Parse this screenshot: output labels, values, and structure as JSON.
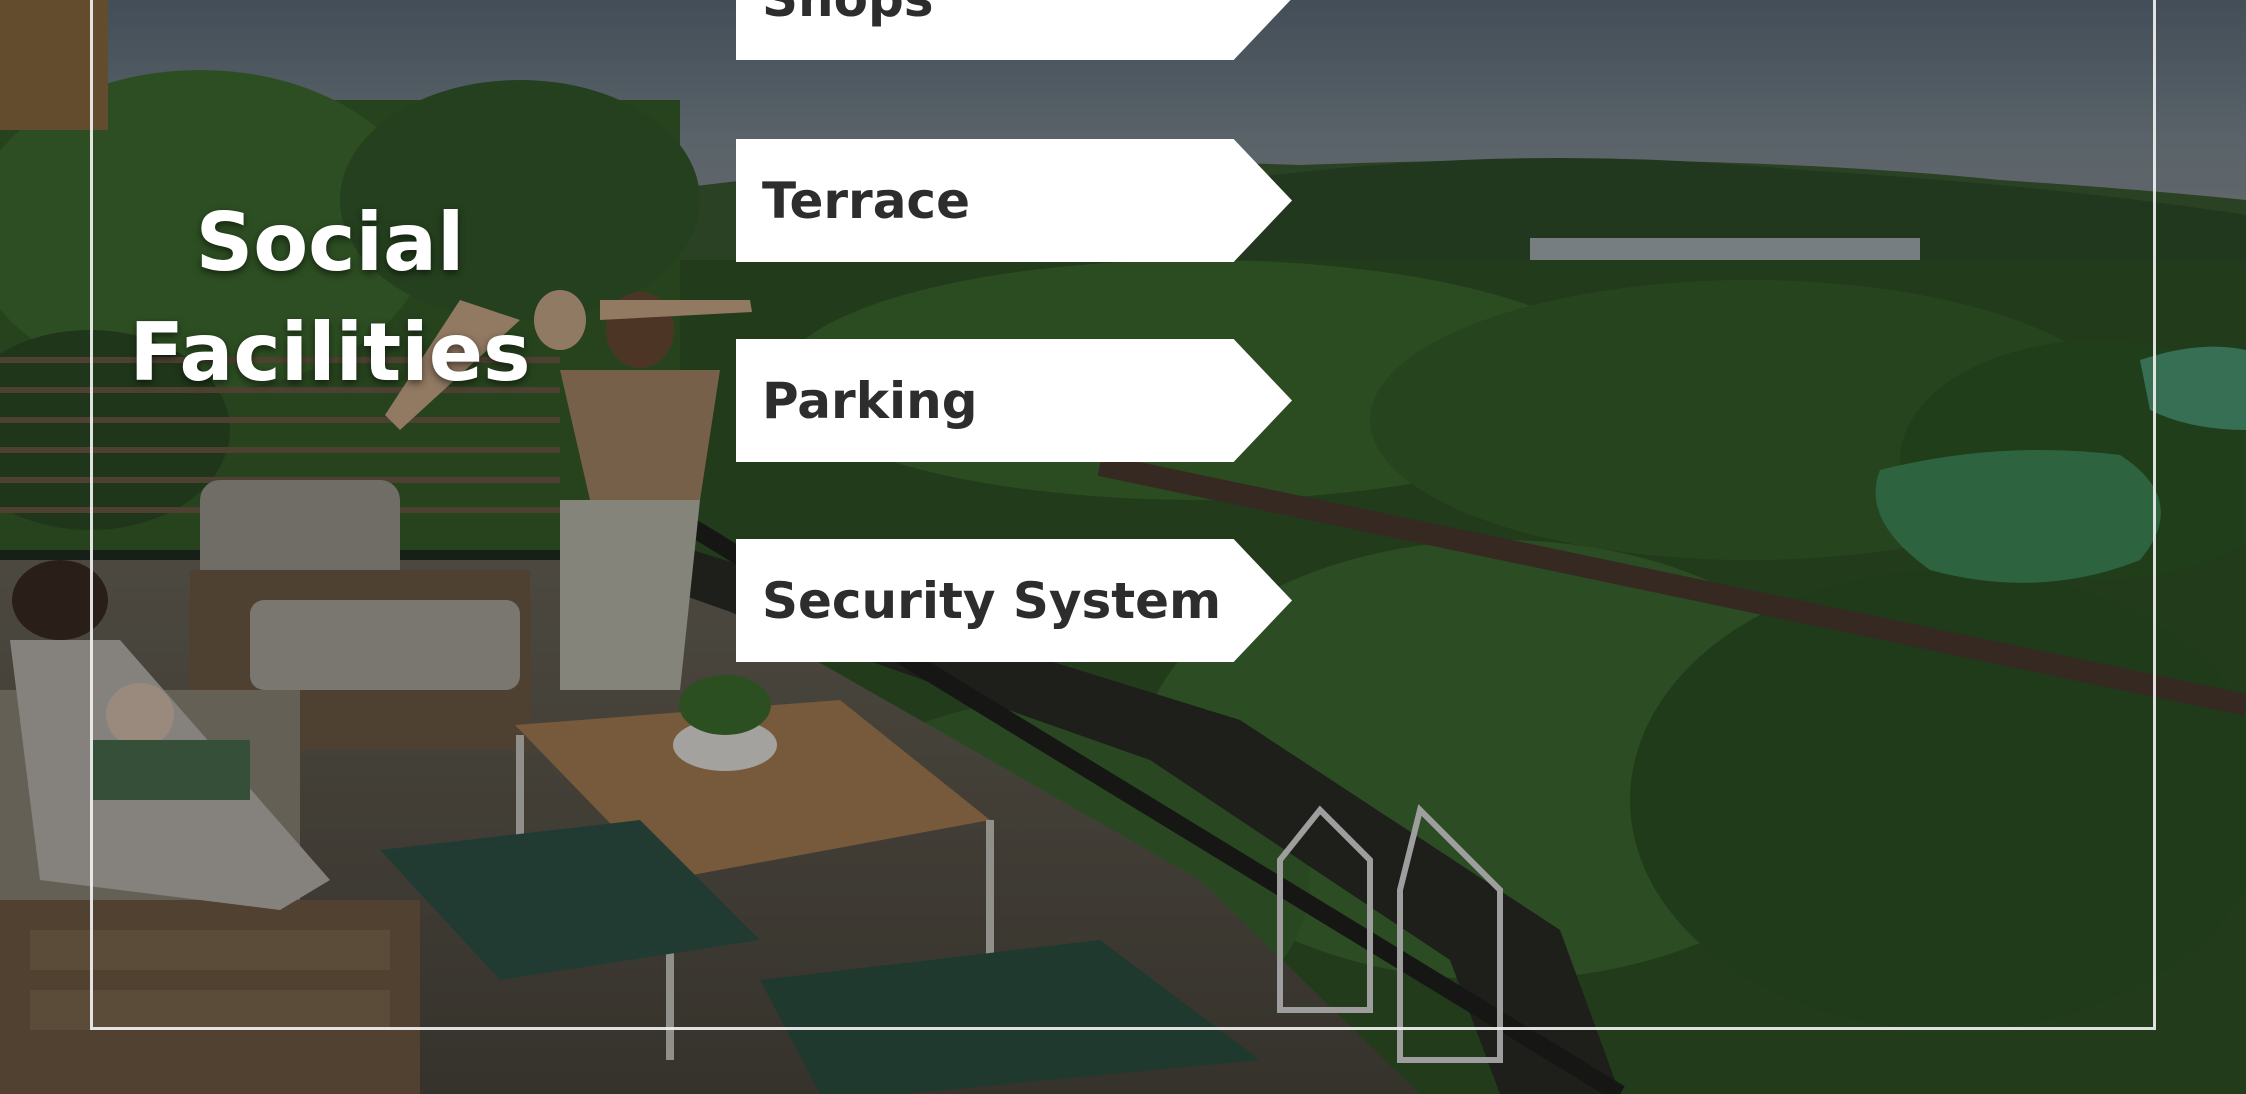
{
  "heading": {
    "line1": "Social",
    "line2": "Facilities"
  },
  "facilities": [
    {
      "label": "Shops"
    },
    {
      "label": "Terrace"
    },
    {
      "label": "Parking"
    },
    {
      "label": "Security System"
    }
  ],
  "colors": {
    "tag_background": "#ffffff",
    "tag_text": "#2d2d2d",
    "heading_text": "#ffffff",
    "frame_border": "#f0f0f0"
  }
}
